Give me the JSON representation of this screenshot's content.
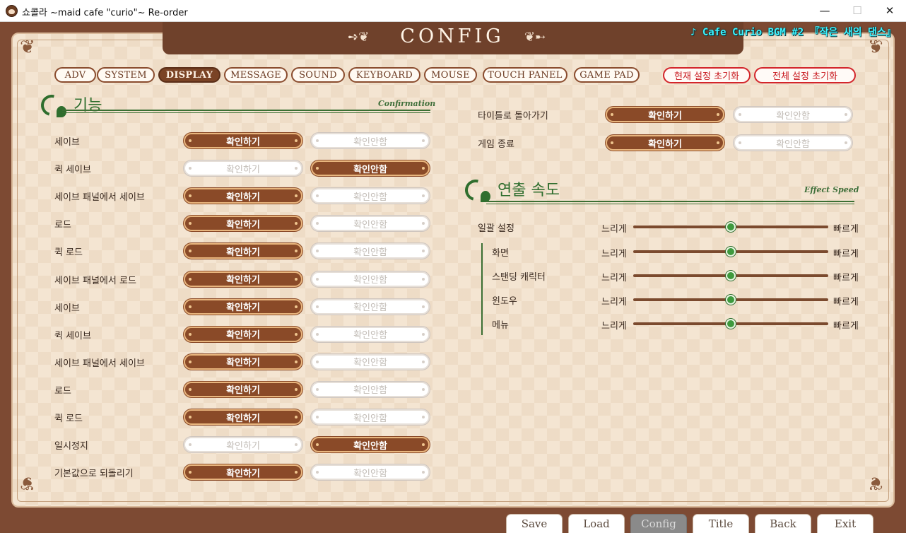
{
  "window": {
    "title": "쇼콜라 ~maid cafe \"curio\"~ Re-order",
    "controls": {
      "minimize": "—",
      "maximize": "☐",
      "close": "✕"
    }
  },
  "header": {
    "title": "CONFIG",
    "flourish_left": "➺❦",
    "flourish_right": "❦➸"
  },
  "bgm": "♪ Cafe Curio BGM #2 『작은 새의 댄스』",
  "tabs": [
    {
      "label": "ADV",
      "active": false
    },
    {
      "label": "SYSTEM",
      "active": false
    },
    {
      "label": "DISPLAY",
      "active": true
    },
    {
      "label": "MESSAGE",
      "active": false
    },
    {
      "label": "SOUND",
      "active": false
    },
    {
      "label": "KEYBOARD",
      "active": false
    },
    {
      "label": "MOUSE",
      "active": false
    },
    {
      "label": "TOUCH PANEL",
      "active": false
    },
    {
      "label": "GAME PAD",
      "active": false
    }
  ],
  "reset": {
    "current": "현재 설정 초기화",
    "all": "전체 설정 초기화"
  },
  "confirm_section": {
    "title": "기능",
    "subtitle": "Confirmation",
    "on_label": "확인하기",
    "off_label": "확인안함",
    "rows": [
      {
        "label": "세이브",
        "value": "on"
      },
      {
        "label": "퀵 세이브",
        "value": "off"
      },
      {
        "label": "세이브 패널에서 세이브",
        "value": "on"
      },
      {
        "label": "로드",
        "value": "on"
      },
      {
        "label": "퀵 로드",
        "value": "on"
      },
      {
        "label": "세이브 패널에서 로드",
        "value": "on"
      },
      {
        "label": "세이브",
        "value": "on"
      },
      {
        "label": "퀵 세이브",
        "value": "on"
      },
      {
        "label": "세이브 패널에서 세이브",
        "value": "on"
      },
      {
        "label": "로드",
        "value": "on"
      },
      {
        "label": "퀵 로드",
        "value": "on"
      },
      {
        "label": "일시정지",
        "value": "off"
      },
      {
        "label": "기본값으로 되돌리기",
        "value": "on"
      }
    ],
    "right_rows": [
      {
        "label": "타이틀로 돌아가기",
        "value": "on"
      },
      {
        "label": "게임 종료",
        "value": "on"
      }
    ]
  },
  "speed_section": {
    "title": "연출 속도",
    "subtitle": "Effect Speed",
    "slow_label": "느리게",
    "fast_label": "빠르게",
    "rows": [
      {
        "label": "일괄 설정",
        "level": 0.5
      },
      {
        "label": "화면",
        "level": 0.5
      },
      {
        "label": "스탠딩 캐릭터",
        "level": 0.5
      },
      {
        "label": "윈도우",
        "level": 0.5
      },
      {
        "label": "메뉴",
        "level": 0.5
      }
    ]
  },
  "bottom_menu": [
    {
      "label": "Save",
      "active": false
    },
    {
      "label": "Load",
      "active": false
    },
    {
      "label": "Config",
      "active": true
    },
    {
      "label": "Title",
      "active": false
    },
    {
      "label": "Back",
      "active": false
    },
    {
      "label": "Exit",
      "active": false
    }
  ],
  "colors": {
    "frame": "#7d4a33",
    "paper": "#f4e5d2",
    "accent_green": "#2f6e2e",
    "button_on": "#8a4a28",
    "reset_red": "#d3252b",
    "bgm_cyan": "#3df4ff"
  }
}
